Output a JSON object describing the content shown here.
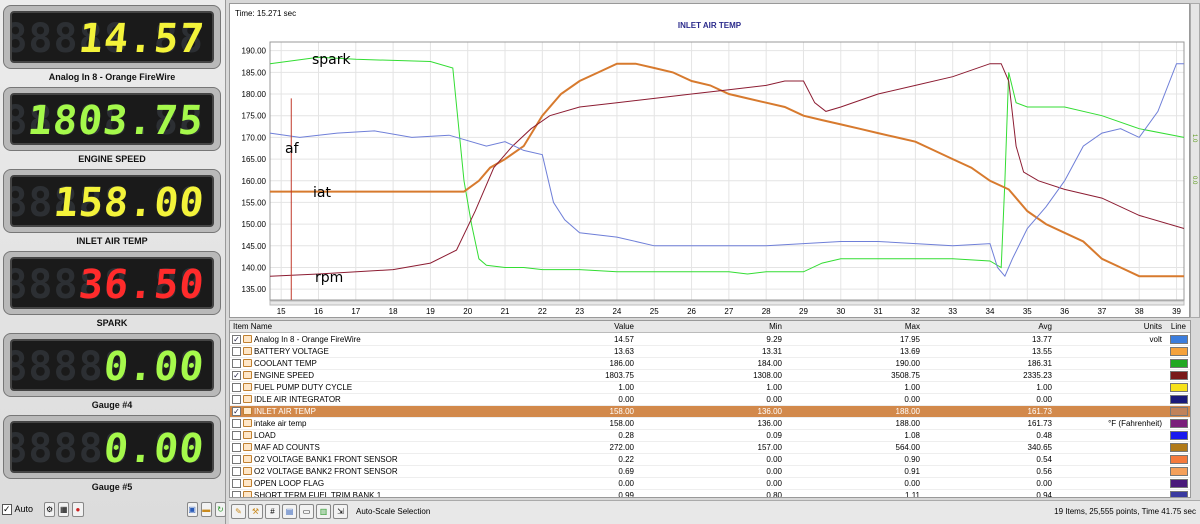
{
  "gauges": [
    {
      "label": "Analog In 8 - Orange FireWire",
      "value": "14.57",
      "ghost": "88888.88",
      "color": "#f3f33a"
    },
    {
      "label": "ENGINE SPEED",
      "value": "1803.75",
      "ghost": "88888.88",
      "color": "#a5f94b"
    },
    {
      "label": "INLET AIR TEMP",
      "value": "158.00",
      "ghost": "88888.88",
      "color": "#f3f33a"
    },
    {
      "label": "SPARK",
      "value": "36.50",
      "ghost": "88888.88",
      "color": "#ff2b2b"
    },
    {
      "label": "Gauge #4",
      "value": "0.00",
      "ghost": "88888.88",
      "color": "#a5f94b"
    },
    {
      "label": "Gauge #5",
      "value": "0.00",
      "ghost": "88888.88",
      "color": "#a5f94b"
    }
  ],
  "gauge_toolbar": {
    "auto_label": "Auto",
    "auto_checked": true
  },
  "chart": {
    "time_label": "Time: 15.271 sec",
    "title": "INLET AIR TEMP",
    "annotations": [
      "spark",
      "af",
      "iat",
      "rpm"
    ],
    "right_labels": [
      "1.0",
      "0.0"
    ]
  },
  "chart_data": {
    "type": "line",
    "title": "INLET AIR TEMP",
    "xlabel": "",
    "ylabel": "",
    "xlim": [
      14.7,
      39.2
    ],
    "ylim": [
      132.5,
      192
    ],
    "x_ticks": [
      15,
      16,
      17,
      18,
      19,
      20,
      21,
      22,
      23,
      24,
      25,
      26,
      27,
      28,
      29,
      30,
      31,
      32,
      33,
      34,
      35,
      36,
      37,
      38,
      39
    ],
    "y_ticks": [
      135,
      140,
      145,
      150,
      155,
      160,
      165,
      170,
      175,
      180,
      185,
      190
    ],
    "grid": true,
    "cursor_x": 15.27,
    "series": [
      {
        "name": "spark",
        "color": "#33dd33",
        "x": [
          14.7,
          16,
          17,
          19,
          19.6,
          19.9,
          20.1,
          20.3,
          20.5,
          21,
          21.5,
          22,
          23,
          24,
          25,
          26,
          27,
          27.5,
          28,
          29,
          29.5,
          30,
          31,
          32,
          33,
          34,
          34.3,
          34.4,
          34.5,
          34.7,
          35,
          36,
          37,
          38,
          39.2
        ],
        "y": [
          187,
          188.5,
          188,
          187.5,
          186,
          160,
          150,
          142,
          140.5,
          140,
          140,
          139.5,
          139.5,
          139,
          139,
          139,
          139,
          138.5,
          139,
          139,
          141,
          142,
          142,
          142,
          142,
          141.5,
          140,
          160,
          185,
          178,
          177,
          177,
          175,
          172,
          170
        ]
      },
      {
        "name": "iat",
        "color": "#d77a2e",
        "x": [
          14.7,
          19.9,
          20.3,
          20.6,
          21,
          21.5,
          22,
          22.5,
          23,
          23.5,
          24,
          24.5,
          25,
          25.5,
          26,
          26.5,
          27,
          27.5,
          28,
          28.5,
          29,
          29.5,
          30,
          30.5,
          31,
          31.5,
          32,
          32.5,
          33,
          33.5,
          34,
          34.5,
          35,
          35.5,
          36,
          36.5,
          37,
          37.5,
          38,
          39.2
        ],
        "y": [
          157.5,
          157.5,
          160,
          163,
          165,
          168,
          175,
          180,
          183,
          185,
          187,
          187,
          186,
          185,
          183,
          182,
          180,
          179,
          178,
          177,
          175,
          174,
          173,
          172,
          171,
          170,
          169,
          167,
          165,
          163,
          160,
          158,
          153,
          150,
          148,
          146,
          142,
          140,
          138,
          138
        ]
      },
      {
        "name": "rpm",
        "color": "#8c1c32",
        "x": [
          14.7,
          16,
          18,
          19,
          19.7,
          20.2,
          20.7,
          21.2,
          21.7,
          22.2,
          23,
          24,
          25,
          26,
          27,
          28,
          28.5,
          29,
          29.3,
          29.6,
          30,
          31,
          32,
          33,
          34,
          34.3,
          34.5,
          34.7,
          34.9,
          35.3,
          36,
          37,
          38,
          39.2
        ],
        "y": [
          138,
          138.5,
          139.5,
          141,
          144,
          153,
          163,
          168,
          172,
          175,
          177,
          178,
          179,
          180,
          181,
          182,
          183,
          183,
          178,
          176,
          177,
          180,
          182,
          184,
          187,
          187,
          183,
          168,
          162,
          160,
          158,
          156,
          152,
          149
        ]
      },
      {
        "name": "af",
        "color": "#6f7fd8",
        "x": [
          14.7,
          15.5,
          16.5,
          17.5,
          18.5,
          19.5,
          20.5,
          21,
          21.5,
          22,
          22.3,
          22.6,
          23,
          24,
          25,
          26,
          27,
          28,
          29,
          30,
          31,
          32,
          33,
          34,
          34.2,
          34.4,
          34.6,
          35,
          35.5,
          36,
          36.5,
          37,
          37.5,
          38,
          38.5,
          39,
          39.2
        ],
        "y": [
          171,
          170,
          171,
          171.5,
          170,
          170.5,
          168,
          169,
          167,
          166,
          155,
          151,
          148,
          147,
          145,
          145,
          145,
          145,
          145.5,
          146,
          146,
          145.5,
          145,
          145.5,
          140,
          138,
          142,
          149,
          154,
          160,
          168,
          171,
          172,
          170,
          176,
          187,
          187
        ]
      }
    ]
  },
  "table": {
    "headers": {
      "name": "Item Name",
      "value": "Value",
      "min": "Min",
      "max": "Max",
      "avg": "Avg",
      "units": "Units",
      "line": "Line"
    },
    "rows": [
      {
        "name": "Analog In 8 - Orange FireWire",
        "value": "14.57",
        "min": "9.29",
        "max": "17.95",
        "avg": "13.77",
        "units": "volt",
        "checked": true,
        "swatch": "#3b7ddd"
      },
      {
        "name": "BATTERY VOLTAGE",
        "value": "13.63",
        "min": "13.31",
        "max": "13.69",
        "avg": "13.55",
        "units": "",
        "checked": false,
        "swatch": "#f5a23c"
      },
      {
        "name": "COOLANT TEMP",
        "value": "186.00",
        "min": "184.00",
        "max": "190.00",
        "avg": "186.31",
        "units": "",
        "checked": false,
        "swatch": "#23a823"
      },
      {
        "name": "ENGINE SPEED",
        "value": "1803.75",
        "min": "1308.00",
        "max": "3508.75",
        "avg": "2335.23",
        "units": "",
        "checked": true,
        "swatch": "#7a1a1a"
      },
      {
        "name": "FUEL PUMP DUTY CYCLE",
        "value": "1.00",
        "min": "1.00",
        "max": "1.00",
        "avg": "1.00",
        "units": "",
        "checked": false,
        "swatch": "#f7e21a"
      },
      {
        "name": "IDLE AIR INTEGRATOR",
        "value": "0.00",
        "min": "0.00",
        "max": "0.00",
        "avg": "0.00",
        "units": "",
        "checked": false,
        "swatch": "#1a1a7a"
      },
      {
        "name": "INLET AIR TEMP",
        "value": "158.00",
        "min": "136.00",
        "max": "188.00",
        "avg": "161.73",
        "units": "",
        "checked": true,
        "swatch": "#c0825a",
        "selected": true
      },
      {
        "name": "intake air temp",
        "value": "158.00",
        "min": "136.00",
        "max": "188.00",
        "avg": "161.73",
        "units": "°F (Fahrenheit)",
        "checked": false,
        "swatch": "#7a1f7a"
      },
      {
        "name": "LOAD",
        "value": "0.28",
        "min": "0.09",
        "max": "1.08",
        "avg": "0.48",
        "units": "",
        "checked": false,
        "swatch": "#1a1aee"
      },
      {
        "name": "MAF AD COUNTS",
        "value": "272.00",
        "min": "157.00",
        "max": "564.00",
        "avg": "340.65",
        "units": "",
        "checked": false,
        "swatch": "#b07a1a"
      },
      {
        "name": "O2 VOLTAGE BANK1 FRONT SENSOR",
        "value": "0.22",
        "min": "0.00",
        "max": "0.90",
        "avg": "0.54",
        "units": "",
        "checked": false,
        "swatch": "#f57a3c"
      },
      {
        "name": "O2 VOLTAGE BANK2 FRONT SENSOR",
        "value": "0.69",
        "min": "0.00",
        "max": "0.91",
        "avg": "0.56",
        "units": "",
        "checked": false,
        "swatch": "#f5a05a"
      },
      {
        "name": "OPEN LOOP FLAG",
        "value": "0.00",
        "min": "0.00",
        "max": "0.00",
        "avg": "0.00",
        "units": "",
        "checked": false,
        "swatch": "#4a1a7a"
      },
      {
        "name": "SHORT TERM FUEL TRIM BANK 1",
        "value": "0.99",
        "min": "0.80",
        "max": "1.11",
        "avg": "0.94",
        "units": "",
        "checked": false,
        "swatch": "#3a3aa0"
      }
    ]
  },
  "bottom_bar": {
    "autoscale_label": "Auto-Scale Selection",
    "status": "19 Items, 25,555 points, Time 41.75 sec"
  }
}
